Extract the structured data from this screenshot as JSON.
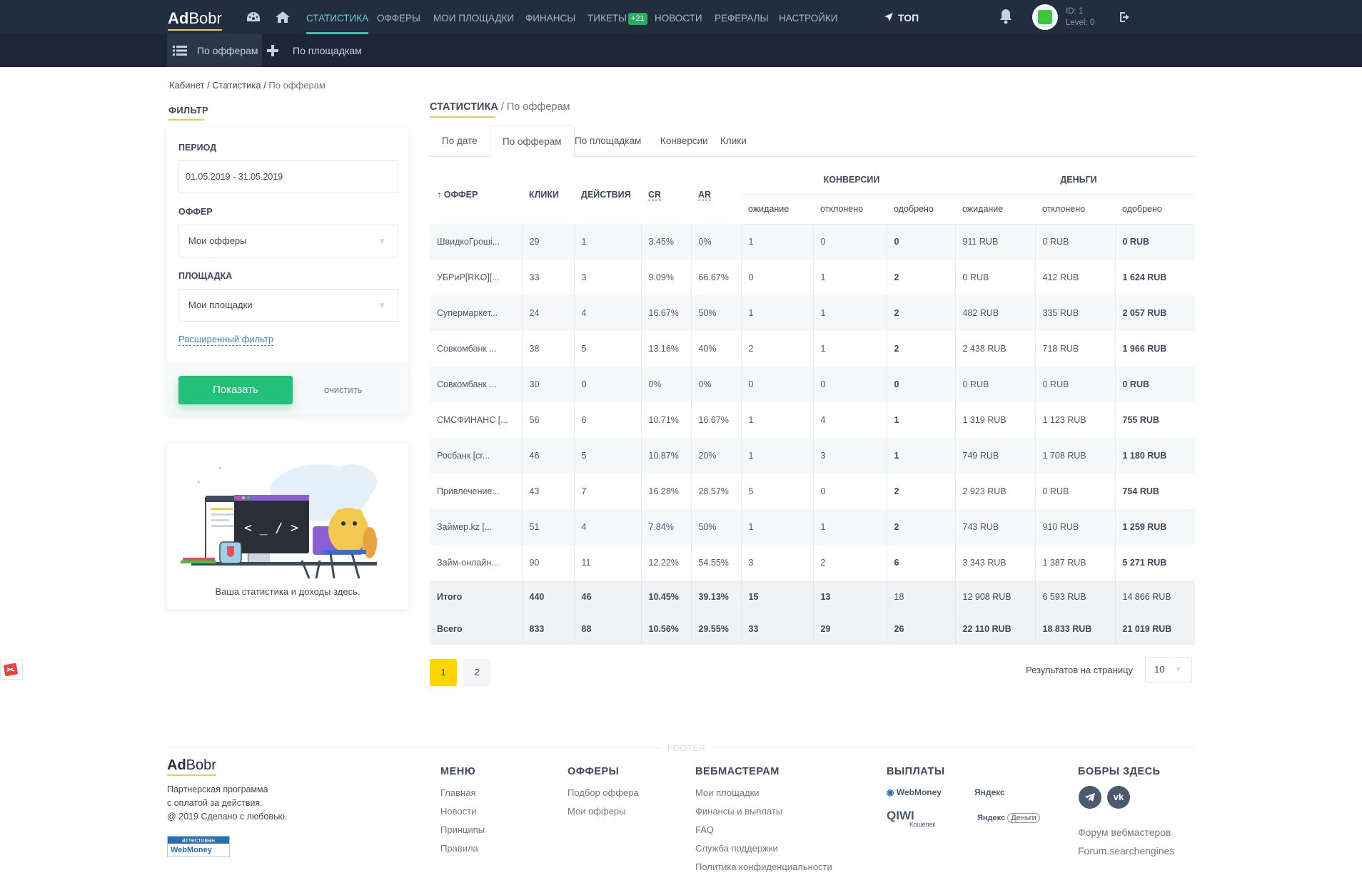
{
  "brand": {
    "logo_bold": "Ad",
    "logo_rest": "Bobr"
  },
  "nav": {
    "items": [
      {
        "label": "Статистика",
        "active": true
      },
      {
        "label": "Офферы"
      },
      {
        "label": "Мои площадки"
      },
      {
        "label": "Финансы"
      },
      {
        "label": "Тикеты",
        "badge": "+21"
      },
      {
        "label": "Новости"
      },
      {
        "label": "Рефералы"
      },
      {
        "label": "Настройки"
      }
    ],
    "top_label": "ТОП",
    "user_id": "ID: 1",
    "user_level": "Level: 0"
  },
  "subnav": {
    "by_offers": "По офферам",
    "by_sites": "По площадкам"
  },
  "breadcrumb": {
    "home": "Кабинет",
    "section": "Статистика",
    "current": "По офферам"
  },
  "filter": {
    "title": "ФИЛЬТР",
    "period_label": "ПЕРИОД",
    "period_value": "01.05.2019 - 31.05.2019",
    "offer_label": "ОФФЕР",
    "offer_value": "Мои офферы",
    "site_label": "ПЛОЩАДКА",
    "site_value": "Мои площадки",
    "advanced": "Расширенный фильтр",
    "show_btn": "Показать",
    "clear_btn": "очистить"
  },
  "promo": {
    "caption": "Ваша статистика и доходы здесь.",
    "code_text": "< _ / >"
  },
  "main": {
    "title": "СТАТИСТИКА",
    "subtitle": "/ По офферам",
    "tabs": [
      "По дате",
      "По офферам",
      "По площадкам",
      "Конверсии",
      "Клики"
    ],
    "active_tab": 1
  },
  "table": {
    "headers": {
      "offer": "↑ ОФФЕР",
      "clicks": "КЛИКИ",
      "actions": "ДЕЙСТВИЯ",
      "cr": "CR",
      "ar": "AR",
      "conversions": "КОНВЕРСИИ",
      "money": "ДЕНЬГИ"
    },
    "sub_headers": [
      "ожидание",
      "отклонено",
      "одобрено",
      "ожидание",
      "отклонено",
      "одобрено"
    ],
    "rows": [
      [
        "ШвидкоГроші...",
        "29",
        "1",
        "3.45%",
        "0%",
        "1",
        "0",
        "0",
        "911 RUB",
        "0 RUB",
        "0 RUB"
      ],
      [
        "УБРиР[RKO][...",
        "33",
        "3",
        "9.09%",
        "66.67%",
        "0",
        "1",
        "2",
        "0 RUB",
        "412 RUB",
        "1 624 RUB"
      ],
      [
        "Супермаркет...",
        "24",
        "4",
        "16.67%",
        "50%",
        "1",
        "1",
        "2",
        "482 RUB",
        "335 RUB",
        "2 057 RUB"
      ],
      [
        "Совкомбанк ...",
        "38",
        "5",
        "13.16%",
        "40%",
        "2",
        "1",
        "2",
        "2 438 RUB",
        "718 RUB",
        "1 966 RUB"
      ],
      [
        "Совкомбанк ...",
        "30",
        "0",
        "0%",
        "0%",
        "0",
        "0",
        "0",
        "0 RUB",
        "0 RUB",
        "0 RUB"
      ],
      [
        "СМСФИНАНС [...",
        "56",
        "6",
        "10.71%",
        "16.67%",
        "1",
        "4",
        "1",
        "1 319 RUB",
        "1 123 RUB",
        "755 RUB"
      ],
      [
        "Росбанк [cr...",
        "46",
        "5",
        "10.87%",
        "20%",
        "1",
        "3",
        "1",
        "749 RUB",
        "1 708 RUB",
        "1 180 RUB"
      ],
      [
        "Привлечение...",
        "43",
        "7",
        "16.28%",
        "28.57%",
        "5",
        "0",
        "2",
        "2 923 RUB",
        "0 RUB",
        "754 RUB"
      ],
      [
        "Займер.kz [...",
        "51",
        "4",
        "7.84%",
        "50%",
        "1",
        "1",
        "2",
        "743 RUB",
        "910 RUB",
        "1 259 RUB"
      ],
      [
        "Займ-онлайн...",
        "90",
        "11",
        "12.22%",
        "54.55%",
        "3",
        "2",
        "6",
        "3 343 RUB",
        "1 387 RUB",
        "5 271 RUB"
      ]
    ],
    "totals": [
      [
        "Итого",
        "440",
        "46",
        "10.45%",
        "39.13%",
        "15",
        "13",
        "18",
        "12 908 RUB",
        "6 593 RUB",
        "14 866 RUB"
      ],
      [
        "Всего",
        "833",
        "88",
        "10.56%",
        "29.55%",
        "33",
        "29",
        "26",
        "22 110 RUB",
        "18 833 RUB",
        "21 019 RUB"
      ]
    ]
  },
  "pagination": {
    "pages": [
      "1",
      "2"
    ],
    "current": "1",
    "per_page_label": "Результатов на страницу",
    "per_page_value": "10"
  },
  "footer": {
    "label": "FOOTER",
    "logo_bold": "Ad",
    "logo_rest": "Bobr",
    "desc1": "Партнерская программа",
    "desc2": "с оплатой за действия.",
    "desc3": "@ 2019 Сделано с любовью.",
    "cert_top": "аттестован",
    "cert_bottom": "WebMoney",
    "menu": {
      "title": "МЕНЮ",
      "links": [
        "Главная",
        "Новости",
        "Принципы",
        "Правила"
      ]
    },
    "offers": {
      "title": "ОФФЕРЫ",
      "links": [
        "Подбор оффера",
        "Мои офферы"
      ]
    },
    "webmasters": {
      "title": "ВЕБМАСТЕРАМ",
      "links": [
        "Мои площадки",
        "Финансы и выплаты",
        "FAQ",
        "Служба поддержки",
        "Политика конфиденциальности"
      ]
    },
    "payouts": {
      "title": "ВЫПЛАТЫ",
      "methods": [
        "WebMoney",
        "Яндекс",
        "QIWI",
        "Кошелек",
        "Яндекс",
        "Деньги"
      ]
    },
    "community": {
      "title": "БОБРЫ ЗДЕСЬ",
      "links": [
        "Форум вебмастеров",
        "Forum.searchengines"
      ],
      "social_vk": "vk"
    }
  }
}
